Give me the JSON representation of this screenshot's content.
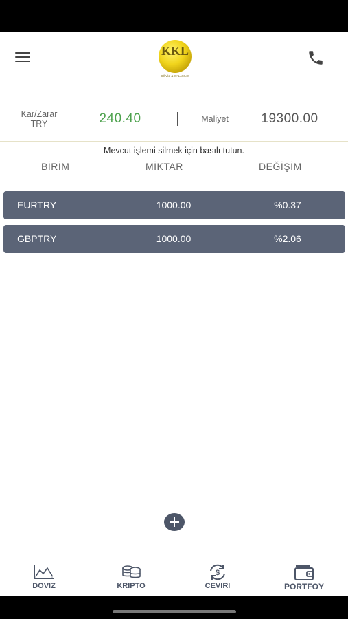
{
  "header": {
    "logo_text": "KKL",
    "logo_subtext": "DÖVİZ & KALAMLIK"
  },
  "summary": {
    "pl_label_line1": "Kar/Zarar",
    "pl_label_line2": "TRY",
    "pl_value": "240.40",
    "cost_label": "Maliyet",
    "cost_value": "19300.00"
  },
  "hint": "Mevcut işlemi silmek için basılı tutun.",
  "columns": {
    "unit": "BİRİM",
    "amount": "MİKTAR",
    "change": "DEĞİŞİM"
  },
  "rows": [
    {
      "unit": "EURTRY",
      "amount": "1000.00",
      "change": "%0.37"
    },
    {
      "unit": "GBPTRY",
      "amount": "1000.00",
      "change": "%2.06"
    }
  ],
  "nav": {
    "doviz": "DOVIZ",
    "kripto": "KRIPTO",
    "ceviri": "CEVIRI",
    "portfoy": "PORTFOY"
  },
  "colors": {
    "accent_gold": "#e8c81a",
    "profit_green": "#4ea24e",
    "row_bg": "#5b6477",
    "nav_icon": "#4d5668"
  },
  "icons": {
    "menu": "hamburger-icon",
    "phone": "phone-icon",
    "add": "plus-icon",
    "doviz": "chart-line-icon",
    "kripto": "coins-icon",
    "ceviri": "currency-exchange-icon",
    "portfoy": "wallet-icon"
  }
}
